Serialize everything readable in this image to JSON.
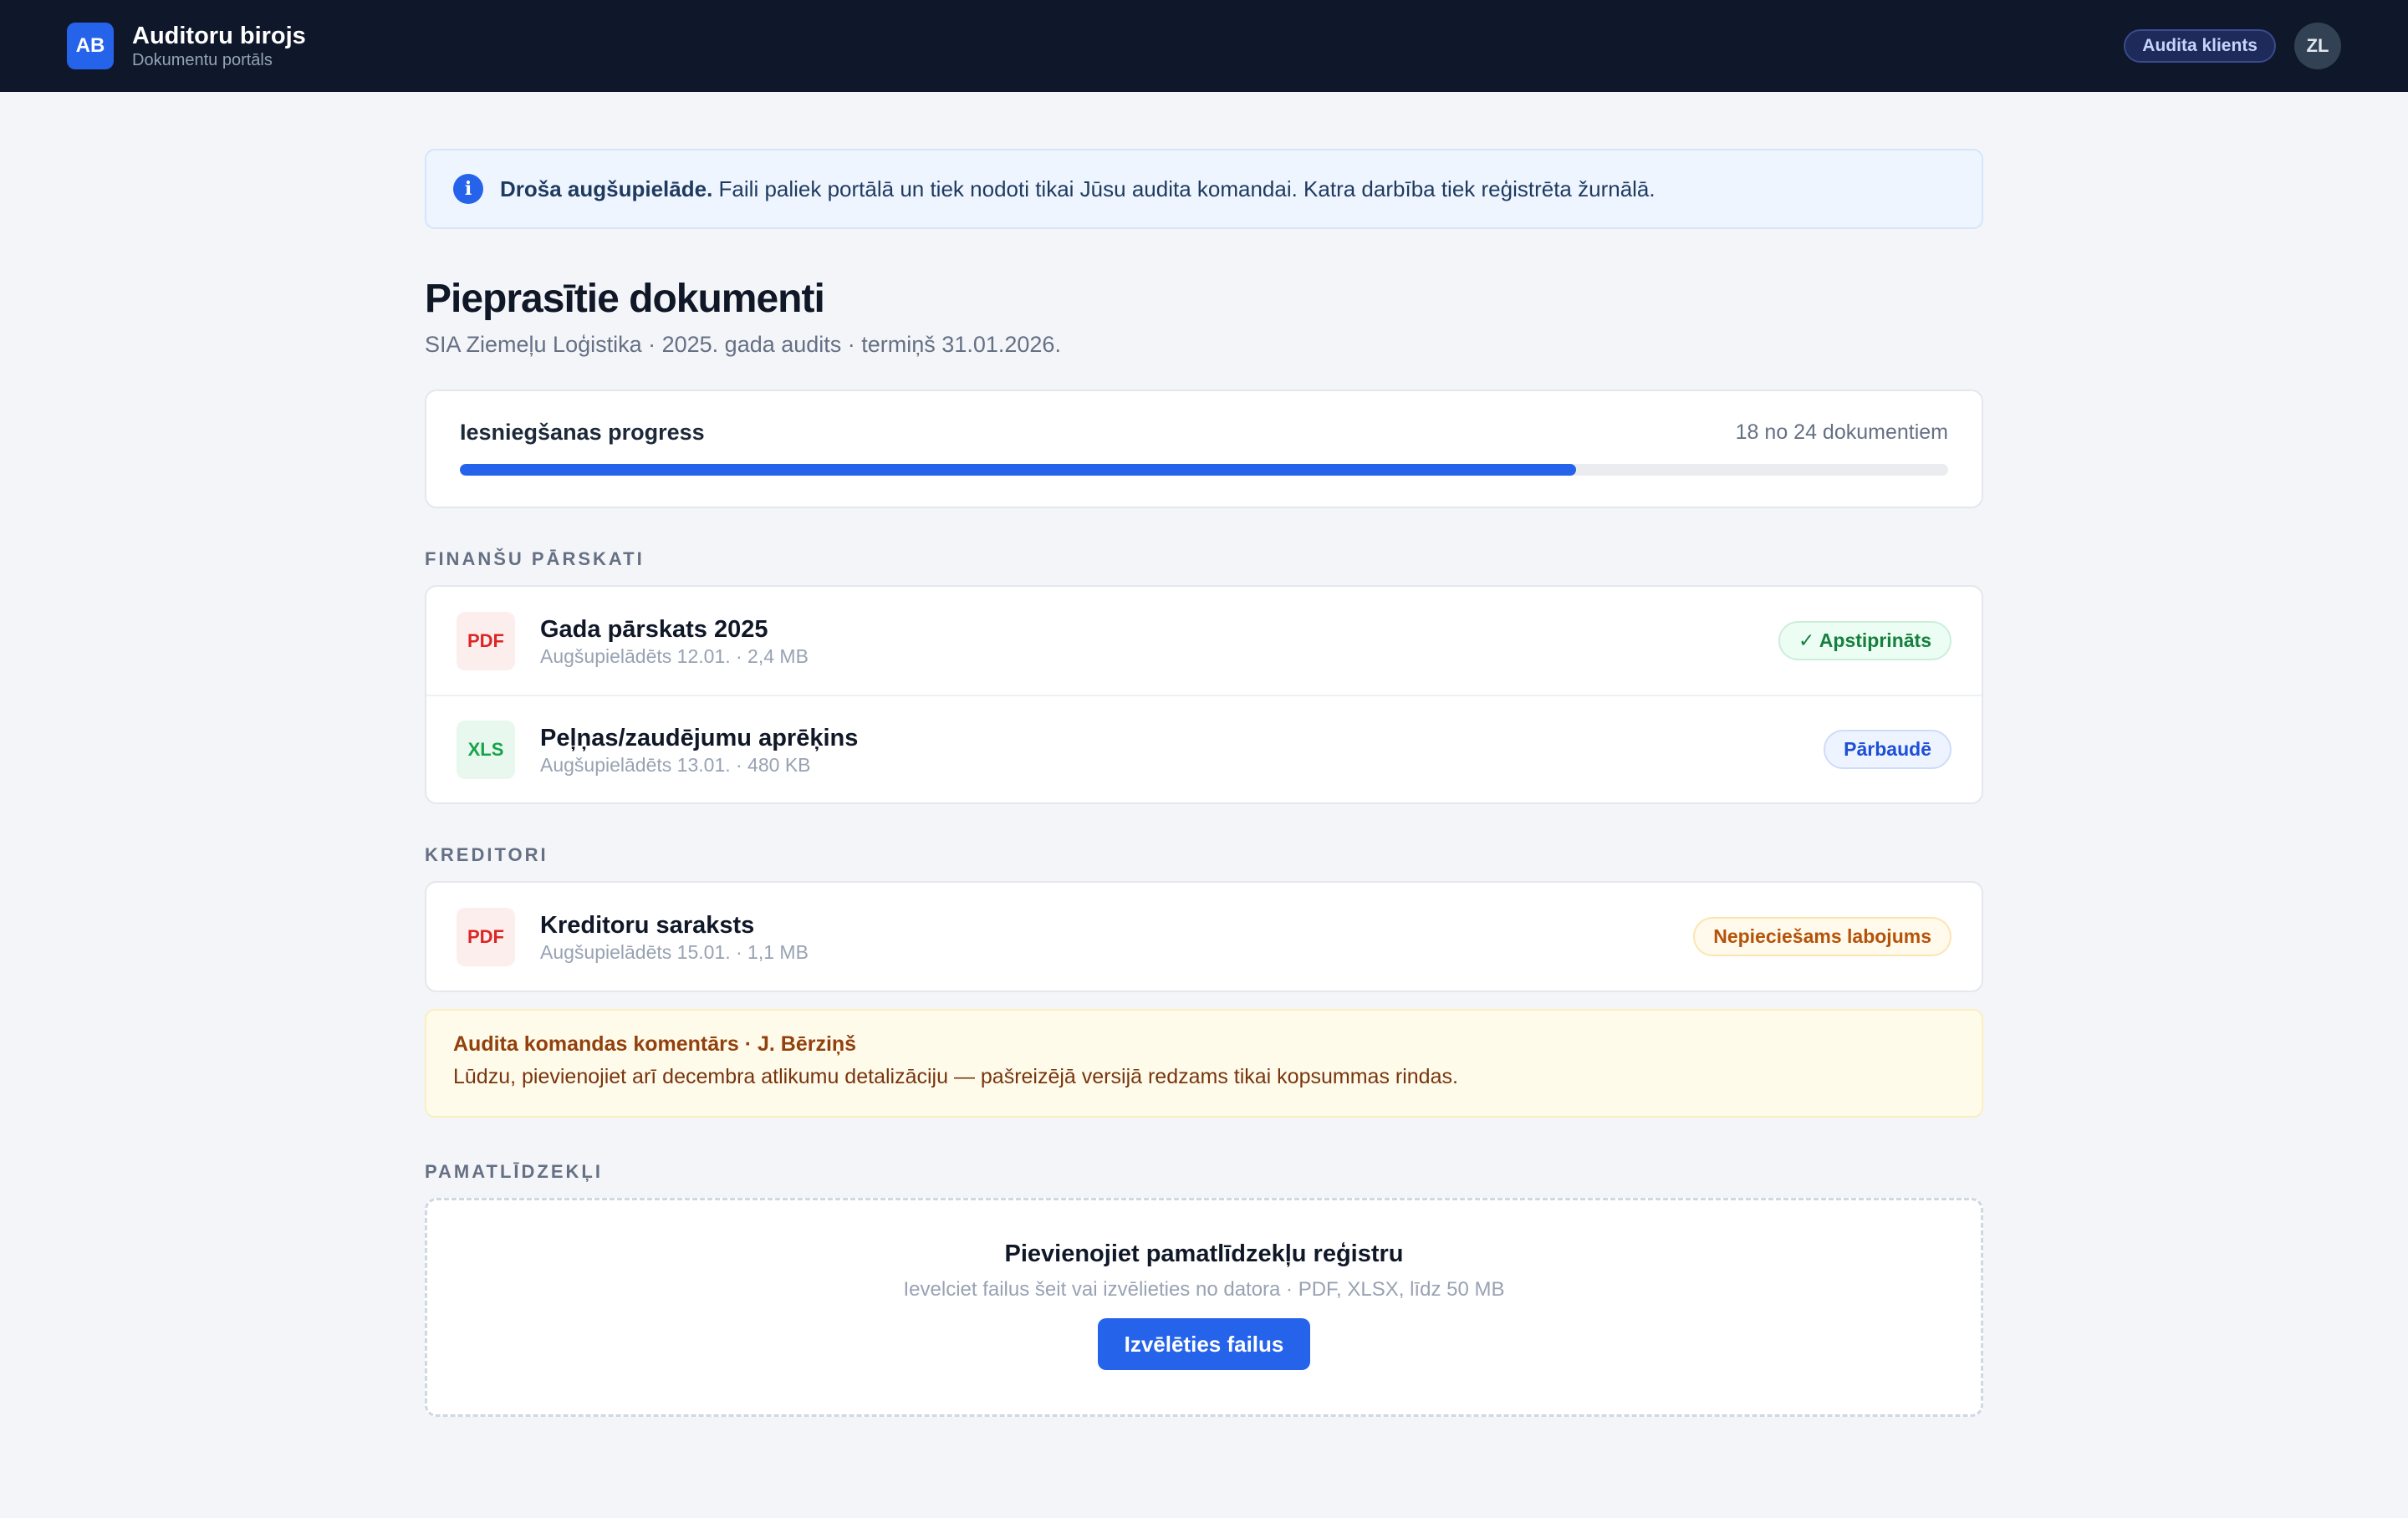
{
  "header": {
    "logo_text": "AB",
    "title": "Auditoru birojs",
    "subtitle": "Dokumentu portāls",
    "role_badge": "Audita klients",
    "avatar_initials": "ZL"
  },
  "notice": {
    "strong": "Droša augšupielāde.",
    "text": "Faili paliek portālā un tiek nodoti tikai Jūsu audita komandai. Katra darbība tiek reģistrēta žurnālā."
  },
  "page": {
    "title": "Pieprasītie dokumenti",
    "subtitle": "SIA Ziemeļu Loģistika · 2025. gada audits · termiņš 31.01.2026."
  },
  "progress": {
    "label": "Iesniegšanas progress",
    "count_text": "18 no 24 dokumentiem",
    "done": 18,
    "total": 24
  },
  "sections": {
    "finance": {
      "label": "FINANŠU PĀRSKATI",
      "docs": [
        {
          "type": "PDF",
          "name": "Gada pārskats 2025",
          "meta": "Augšupielādēts 12.01. · 2,4 MB",
          "status": "✓ Apstiprināts"
        },
        {
          "type": "XLS",
          "name": "Peļņas/zaudējumu aprēķins",
          "meta": "Augšupielādēts 13.01. · 480 KB",
          "status": "Pārbaudē"
        }
      ]
    },
    "creditors": {
      "label": "KREDITORI",
      "docs": [
        {
          "type": "PDF",
          "name": "Kreditoru saraksts",
          "meta": "Augšupielādēts 15.01. · 1,1 MB",
          "status": "Nepieciešams labojums"
        }
      ],
      "comment": {
        "title": "Audita komandas komentārs · J. Bērziņš",
        "body": "Lūdzu, pievienojiet arī decembra atlikumu detalizāciju — pašreizējā versijā redzams tikai kopsummas rindas."
      }
    },
    "assets": {
      "label": "PAMATLĪDZEKĻI",
      "upload": {
        "title": "Pievienojiet pamatlīdzekļu reģistru",
        "hint": "Ievelciet failus šeit vai izvēlieties no datora · PDF, XLSX, līdz 50 MB",
        "button": "Izvēlēties failus"
      }
    }
  },
  "colors": {
    "accent": "#2563eb",
    "topbar": "#0f172a",
    "approved": "#15803d",
    "review": "#1d4ed8",
    "needs_fix": "#b45309"
  },
  "icons": [
    "info-icon",
    "pdf-file-icon",
    "xls-file-icon",
    "checkmark-icon"
  ]
}
